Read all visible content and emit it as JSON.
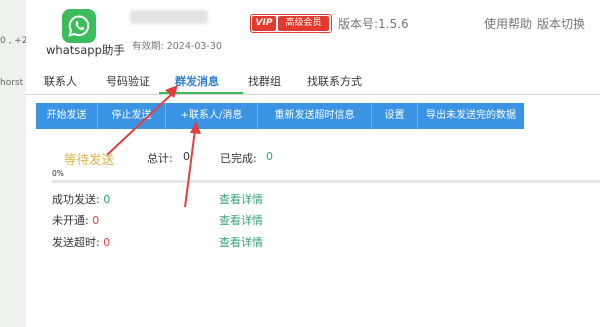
{
  "background": {
    "text_1": "0 , +2",
    "text_2": "horst"
  },
  "header": {
    "app_name": "whatsapp助手",
    "expiry": "有效期: 2024-03-30",
    "vip_tag": "VIP",
    "vip_label": "高级会员",
    "version": "版本号:1.5.6",
    "help": "使用帮助",
    "switch_version": "版本切换"
  },
  "tabs": [
    {
      "label": "联系人"
    },
    {
      "label": "号码验证"
    },
    {
      "label": "群发消息"
    },
    {
      "label": "找群组"
    },
    {
      "label": "找联系方式"
    }
  ],
  "active_tab": "群发消息",
  "toolbar": {
    "buttons": [
      {
        "label": "开始发送"
      },
      {
        "label": "停止发送"
      },
      {
        "label": "+联系人/消息"
      },
      {
        "label": "重新发送超时信息"
      },
      {
        "label": "设置"
      },
      {
        "label": "导出未发送完的数据"
      }
    ]
  },
  "status": {
    "state": "等待发送",
    "total_label": "总计:",
    "total_value": "0",
    "done_label": "已完成:",
    "done_value": "0",
    "progress_text": "0%",
    "progress_fraction": 0
  },
  "stats": [
    {
      "label": "成功发送:",
      "value": "0",
      "value_color": "#3aa37a",
      "link": "查看详情"
    },
    {
      "label": "未开通:",
      "value": "0",
      "value_color": "#e04040",
      "link": "查看详情"
    },
    {
      "label": "发送超时:",
      "value": "0",
      "value_color": "#e04040",
      "link": "查看详情"
    }
  ],
  "expand_glyph": ">",
  "colors": {
    "accent_blue": "#3a93e5",
    "whatsapp_green": "#3bbd5c",
    "vip_red": "#e23a2f",
    "waiting_orange": "#e0b34c",
    "link_green": "#3aa37a",
    "annotation_red": "#e2403a"
  }
}
